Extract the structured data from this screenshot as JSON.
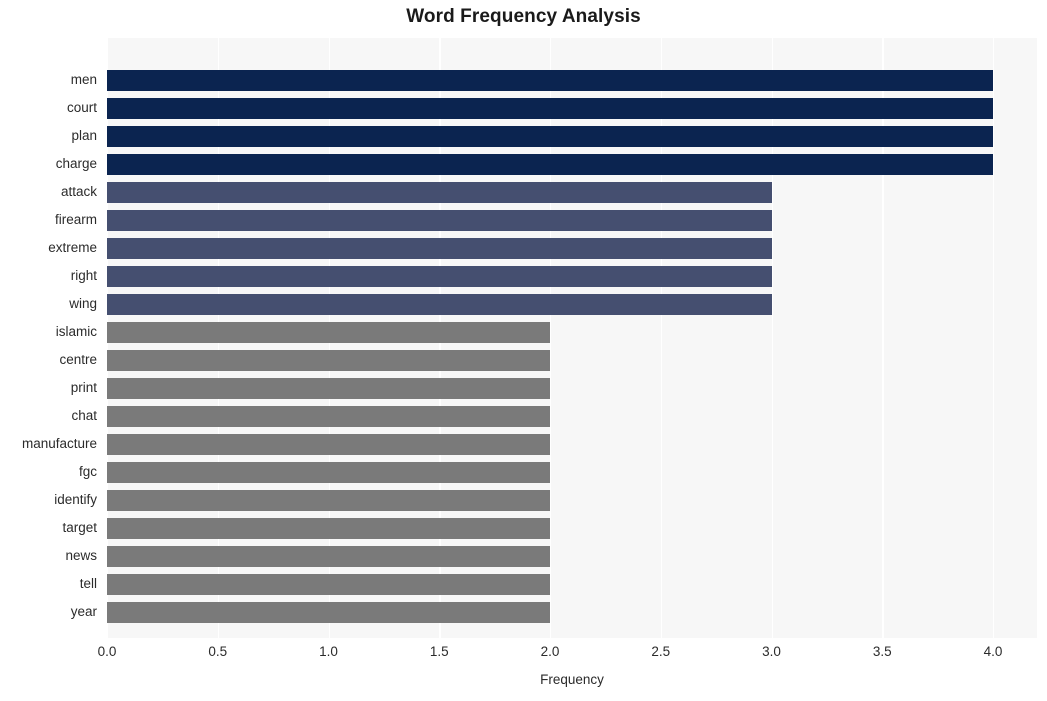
{
  "chart_data": {
    "type": "bar",
    "orientation": "horizontal",
    "title": "Word Frequency Analysis",
    "xlabel": "Frequency",
    "ylabel": "",
    "categories": [
      "men",
      "court",
      "plan",
      "charge",
      "attack",
      "firearm",
      "extreme",
      "right",
      "wing",
      "islamic",
      "centre",
      "print",
      "chat",
      "manufacture",
      "fgc",
      "identify",
      "target",
      "news",
      "tell",
      "year"
    ],
    "values": [
      4,
      4,
      4,
      4,
      3,
      3,
      3,
      3,
      3,
      2,
      2,
      2,
      2,
      2,
      2,
      2,
      2,
      2,
      2,
      2
    ],
    "bar_colors": [
      "#0b2450",
      "#0b2450",
      "#0b2450",
      "#0b2450",
      "#454f70",
      "#454f70",
      "#454f70",
      "#454f70",
      "#454f70",
      "#7a7a7a",
      "#7a7a7a",
      "#7a7a7a",
      "#7a7a7a",
      "#7a7a7a",
      "#7a7a7a",
      "#7a7a7a",
      "#7a7a7a",
      "#7a7a7a",
      "#7a7a7a",
      "#7a7a7a"
    ],
    "xlim": [
      0.0,
      4.2
    ],
    "x_ticks": [
      "0.0",
      "0.5",
      "1.0",
      "1.5",
      "2.0",
      "2.5",
      "3.0",
      "3.5",
      "4.0"
    ],
    "x_tick_values": [
      0.0,
      0.5,
      1.0,
      1.5,
      2.0,
      2.5,
      3.0,
      3.5,
      4.0
    ],
    "grid": true,
    "grid_axis": "x",
    "legend": false,
    "plot_background": "#f7f7f7",
    "figure_background": "#ffffff",
    "gridline_color": "#ffffff"
  }
}
